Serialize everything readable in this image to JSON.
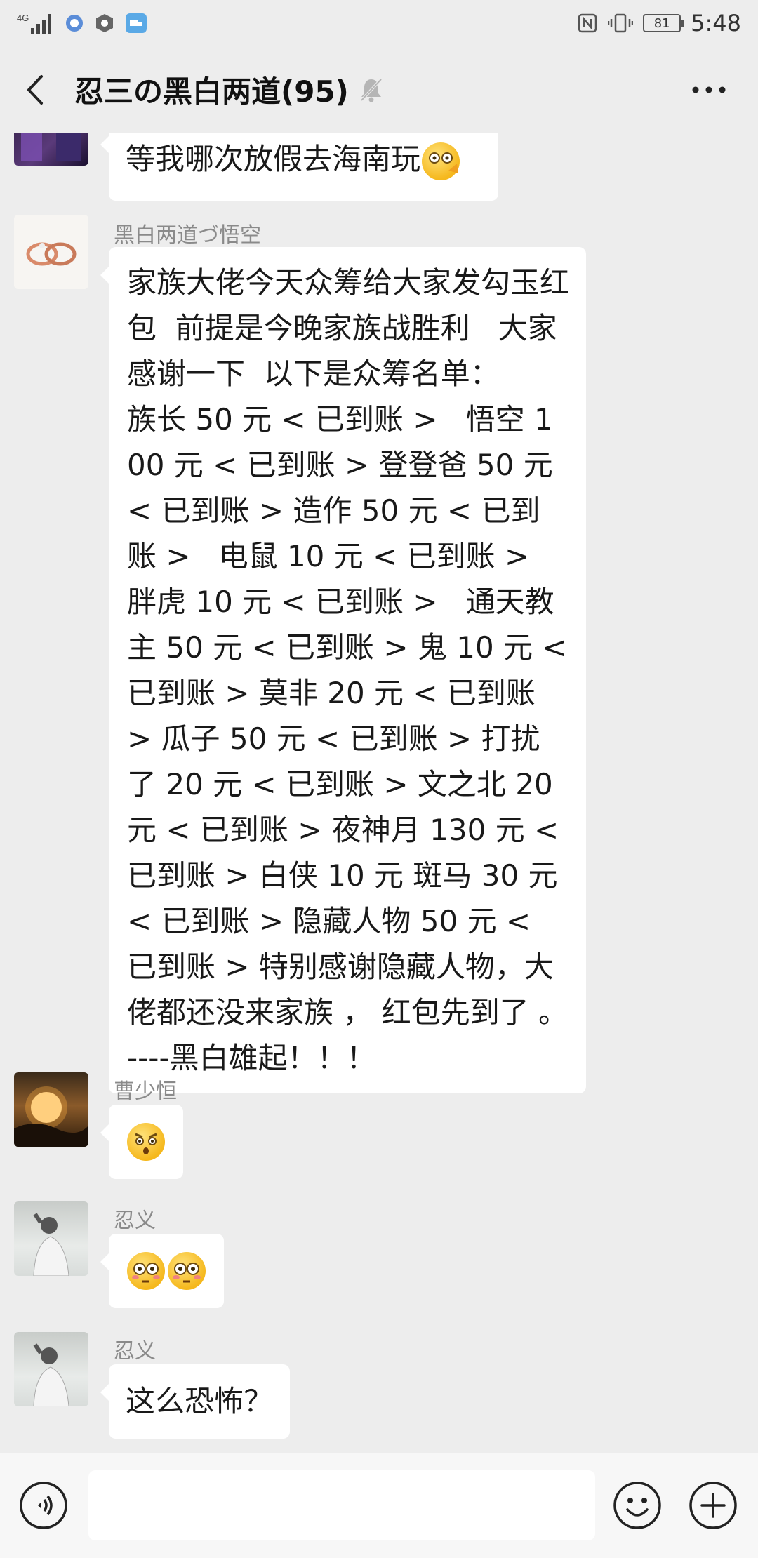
{
  "status_bar": {
    "network": "4G",
    "battery": "81",
    "time": "5:48"
  },
  "header": {
    "title": "忍三の黑白两道(95)"
  },
  "messages": [
    {
      "sender": "",
      "text": "等我哪次放假去海南玩"
    },
    {
      "sender": "黑白两道づ悟空",
      "text": "家族大佬今天众筹给大家发勾玉红包  前提是今晚家族战胜利   大家感谢一下  以下是众筹名单：                    族长 50 元 < 已到账 >   悟空 100 元 < 已到账 > 登登爸 50 元 < 已到账 > 造作 50 元 < 已到账 >   电鼠 10 元 < 已到账 >   胖虎 10 元 < 已到账 >   通天教主 50 元 < 已到账 > 鬼 10 元 < 已到账 > 莫非 20 元 < 已到账 > 瓜子 50 元 < 已到账 > 打扰了 20 元 < 已到账 > 文之北 20 元 < 已到账 > 夜神月 130 元 < 已到账 > 白侠 10 元 斑马 30 元 < 已到账 > 隐藏人物 50 元 < 已到账 > 特别感谢隐藏人物，大佬都还没来家族 ， 红包先到了 。----黑白雄起！！！"
    },
    {
      "sender": "曹少恒",
      "text": ""
    },
    {
      "sender": "忍义",
      "text": ""
    },
    {
      "sender": "忍义",
      "text": "这么恐怖？"
    }
  ],
  "input": {
    "value": ""
  },
  "colors": {
    "background": "#EDEDED",
    "bubble": "#FFFFFF",
    "input_bar": "#F7F7F7"
  }
}
